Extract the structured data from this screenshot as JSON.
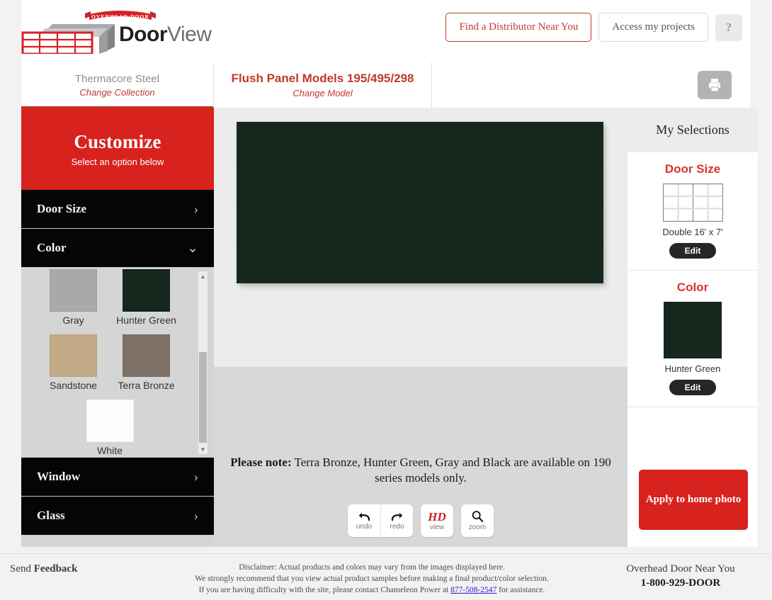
{
  "brand": {
    "ribbon_text": "OVERHEAD DOOR",
    "name_bold": "Door",
    "name_light": "View"
  },
  "header": {
    "find_distributor_label": "Find a Distributor Near You",
    "access_projects_label": "Access my projects",
    "help_label": "?"
  },
  "tabs": {
    "collection": {
      "title": "Thermacore Steel",
      "action": "Change Collection"
    },
    "model": {
      "title": "Flush Panel Models 195/495/298",
      "action": "Change Model"
    },
    "print_icon": "printer-icon"
  },
  "sidebar": {
    "customize_title": "Customize",
    "customize_subtitle": "Select an option below",
    "menu": [
      {
        "label": "Door Size",
        "chevron": "›"
      },
      {
        "label": "Color",
        "chevron": "⌄"
      },
      {
        "label": "Window",
        "chevron": "›"
      },
      {
        "label": "Glass",
        "chevron": "›"
      }
    ],
    "colors": [
      {
        "label": "Gray",
        "hex": "#a9a9a7"
      },
      {
        "label": "Hunter Green",
        "hex": "#16281e"
      },
      {
        "label": "Sandstone",
        "hex": "#c2ab86"
      },
      {
        "label": "Terra Bronze",
        "hex": "#7e7167"
      },
      {
        "label": "White",
        "hex": "#fdfdfb"
      }
    ],
    "scroll_up_icon": "▲",
    "scroll_down_icon": "▼"
  },
  "viewer": {
    "door_color_hex": "#16281e",
    "note_prefix": "Please note:",
    "note_text": " Terra Bronze, Hunter Green, Gray and Black are available on 190 series models only.",
    "tools": [
      {
        "name": "undo",
        "label": "undo",
        "icon": "undo-arrow-icon"
      },
      {
        "name": "redo",
        "label": "redo",
        "icon": "redo-arrow-icon"
      },
      {
        "name": "hd-view",
        "label": "view",
        "glyph": "HD"
      },
      {
        "name": "zoom",
        "label": "zoom",
        "icon": "magnifier-icon"
      }
    ]
  },
  "selections": {
    "heading": "My Selections",
    "door_size": {
      "title": "Door Size",
      "caption": "Double 16' x 7'",
      "edit_label": "Edit"
    },
    "color": {
      "title": "Color",
      "caption": "Hunter Green",
      "hex": "#16281e",
      "edit_label": "Edit"
    },
    "apply_label": "Apply to home photo"
  },
  "footer": {
    "feedback_lead": "Send ",
    "feedback_bold": "Feedback",
    "disclaimer_line1": "Disclaimer: Actual products and colors may vary from the images displayed here.",
    "disclaimer_line2": "We strongly recommend that you view actual product samples before making a final product/color selection.",
    "disclaimer_line3_pre": "If you are having difficulty with the site, please contact Chameleon Power at ",
    "disclaimer_phone": "877-508-2547",
    "disclaimer_line3_post": " for assistance.",
    "near_you_label": "Overhead Door Near You",
    "near_you_phone": "1-800-929-DOOR"
  },
  "colors": {
    "brand_red": "#d8221d",
    "accent_red": "#c0392b",
    "menu_black": "#050505"
  }
}
